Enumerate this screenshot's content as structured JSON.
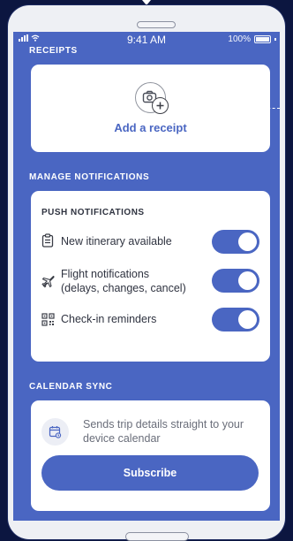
{
  "status_bar": {
    "time": "9:41 AM",
    "battery": "100%"
  },
  "receipts": {
    "section_title": "RECEIPTS",
    "add_label": "Add a receipt"
  },
  "notifications": {
    "section_title": "MANAGE NOTIFICATIONS",
    "card_title": "PUSH NOTIFICATIONS",
    "items": [
      {
        "label": "New itinerary available",
        "icon": "clipboard-icon",
        "enabled": true
      },
      {
        "label_line1": "Flight notifications",
        "label_line2": "(delays, changes, cancel)",
        "icon": "airplane-icon",
        "enabled": true
      },
      {
        "label": "Check-in reminders",
        "icon": "qr-code-icon",
        "enabled": true
      }
    ]
  },
  "calendar_sync": {
    "section_title": "CALENDAR SYNC",
    "description_line1": "Sends trip details straight to your",
    "description_line2": "device calendar",
    "subscribe_label": "Subscribe",
    "icon": "calendar-sync-icon"
  },
  "colors": {
    "accent": "#4a66c2",
    "background": "#0c1640",
    "card": "#ffffff"
  }
}
